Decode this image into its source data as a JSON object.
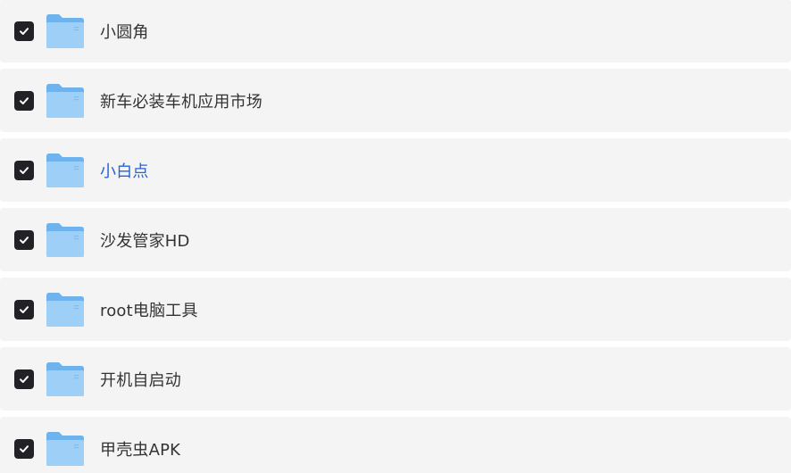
{
  "colors": {
    "row_background": "#f4f4f4",
    "checkbox": "#222226",
    "folder_light": "#9ed0f7",
    "folder_dark": "#6fb3ee",
    "text": "#333333",
    "active_text": "#2463d6"
  },
  "files": [
    {
      "name": "小圆角",
      "checked": true,
      "active": false,
      "icon": "folder-icon"
    },
    {
      "name": "新车必装车机应用市场",
      "checked": true,
      "active": false,
      "icon": "folder-icon"
    },
    {
      "name": "小白点",
      "checked": true,
      "active": true,
      "icon": "folder-icon"
    },
    {
      "name": "沙发管家HD",
      "checked": true,
      "active": false,
      "icon": "folder-icon"
    },
    {
      "name": "root电脑工具",
      "checked": true,
      "active": false,
      "icon": "folder-icon"
    },
    {
      "name": "开机自启动",
      "checked": true,
      "active": false,
      "icon": "folder-icon"
    },
    {
      "name": "甲壳虫APK",
      "checked": true,
      "active": false,
      "icon": "folder-icon"
    }
  ]
}
